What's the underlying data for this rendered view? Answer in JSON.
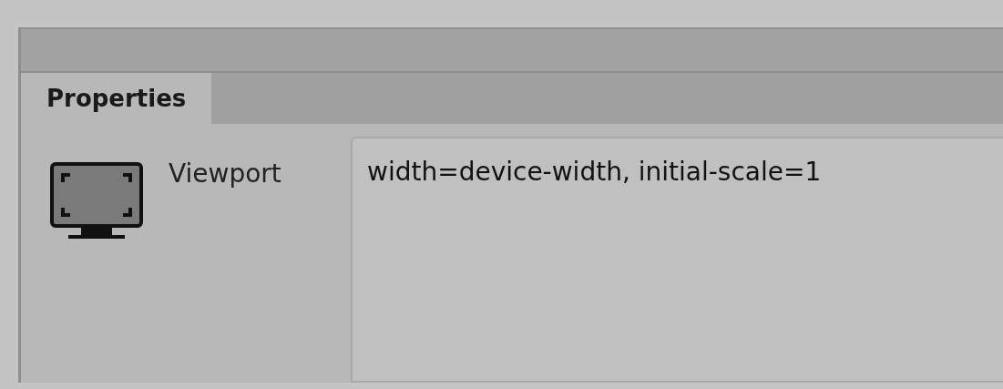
{
  "tabs": [
    {
      "label": "Properties",
      "selected": true
    }
  ],
  "property": {
    "label": "Viewport",
    "value": "width=device-width, initial-scale=1"
  }
}
